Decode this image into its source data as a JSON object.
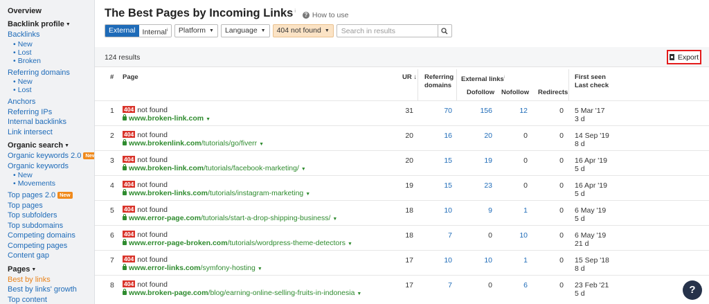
{
  "sidebar": {
    "overview": "Overview",
    "backlink_profile": "Backlink profile",
    "backlinks": "Backlinks",
    "backlinks_sub": [
      "New",
      "Lost",
      "Broken"
    ],
    "referring_domains": "Referring domains",
    "referring_domains_sub": [
      "New",
      "Lost"
    ],
    "anchors": "Anchors",
    "referring_ips": "Referring IPs",
    "internal_backlinks": "Internal backlinks",
    "link_intersect": "Link intersect",
    "organic_search": "Organic search",
    "organic_keywords_2": "Organic keywords 2.0",
    "organic_keywords": "Organic keywords",
    "organic_keywords_sub": [
      "New",
      "Movements"
    ],
    "top_pages_2": "Top pages 2.0",
    "top_pages": "Top pages",
    "top_subfolders": "Top subfolders",
    "top_subdomains": "Top subdomains",
    "competing_domains": "Competing domains",
    "competing_pages": "Competing pages",
    "content_gap": "Content gap",
    "pages": "Pages",
    "best_by_links": "Best by links",
    "best_by_links_growth": "Best by links' growth",
    "top_content": "Top content",
    "new_badge": "New"
  },
  "header": {
    "title": "The Best Pages by Incoming Links",
    "title_info": "i",
    "how_to_use": "How to use"
  },
  "filters": {
    "external": "External",
    "internal": "Internal",
    "internal_info": "i",
    "platform": "Platform",
    "language": "Language",
    "status": "404 not found",
    "search_placeholder": "Search in results"
  },
  "results_count": "124 results",
  "export_label": "Export",
  "columns": {
    "num": "#",
    "page": "Page",
    "ur": "UR",
    "ur_sort": "↓",
    "ref_domains_1": "Referring",
    "ref_domains_2": "domains",
    "external_links": "External links",
    "external_info": "i",
    "dofollow": "Dofollow",
    "nofollow": "Nofollow",
    "redirects": "Redirects",
    "first_seen": "First seen",
    "last_check": "Last check"
  },
  "status_badge": "404",
  "status_text": "not found",
  "rows": [
    {
      "n": "1",
      "domain": "www.broken-link.com",
      "path": "",
      "ur": "31",
      "rd": "70",
      "dofollow": "156",
      "nofollow": "12",
      "redirects": "0",
      "first_seen": "5 Mar '17",
      "last_check": "3 d"
    },
    {
      "n": "2",
      "domain": "www.brokenlink.com",
      "path": "/tutorials/go/fiverr",
      "ur": "20",
      "rd": "16",
      "dofollow": "20",
      "nofollow": "0",
      "redirects": "0",
      "first_seen": "14 Sep '19",
      "last_check": "8 d"
    },
    {
      "n": "3",
      "domain": "www.broken-link.com",
      "path": "/tutorials/facebook-marketing/",
      "ur": "20",
      "rd": "15",
      "dofollow": "19",
      "nofollow": "0",
      "redirects": "0",
      "first_seen": "16 Apr '19",
      "last_check": "5 d"
    },
    {
      "n": "4",
      "domain": "www.broken-links.com",
      "path": "/tutorials/instagram-marketing",
      "ur": "19",
      "rd": "15",
      "dofollow": "23",
      "nofollow": "0",
      "redirects": "0",
      "first_seen": "16 Apr '19",
      "last_check": "5 d"
    },
    {
      "n": "5",
      "domain": "www.error-page.com",
      "path": "/tutorials/start-a-drop-shipping-business/",
      "ur": "18",
      "rd": "10",
      "dofollow": "9",
      "nofollow": "1",
      "redirects": "0",
      "first_seen": "6 May '19",
      "last_check": "5 d"
    },
    {
      "n": "6",
      "domain": "www.error-page-broken.com",
      "path": "/tutorials/wordpress-theme-detectors",
      "ur": "18",
      "rd": "7",
      "dofollow": "0",
      "nofollow": "10",
      "redirects": "0",
      "first_seen": "6 May '19",
      "last_check": "21 d"
    },
    {
      "n": "7",
      "domain": "www.error-links.com",
      "path": "/symfony-hosting",
      "ur": "17",
      "rd": "10",
      "dofollow": "10",
      "nofollow": "1",
      "redirects": "0",
      "first_seen": "15 Sep '18",
      "last_check": "8 d"
    },
    {
      "n": "8",
      "domain": "www.broken-page.com",
      "path": "/blog/earning-online-selling-fruits-in-indonesia",
      "ur": "17",
      "rd": "7",
      "dofollow": "0",
      "nofollow": "6",
      "redirects": "0",
      "first_seen": "23 Feb '21",
      "last_check": "5 d"
    }
  ],
  "help_label": "?"
}
